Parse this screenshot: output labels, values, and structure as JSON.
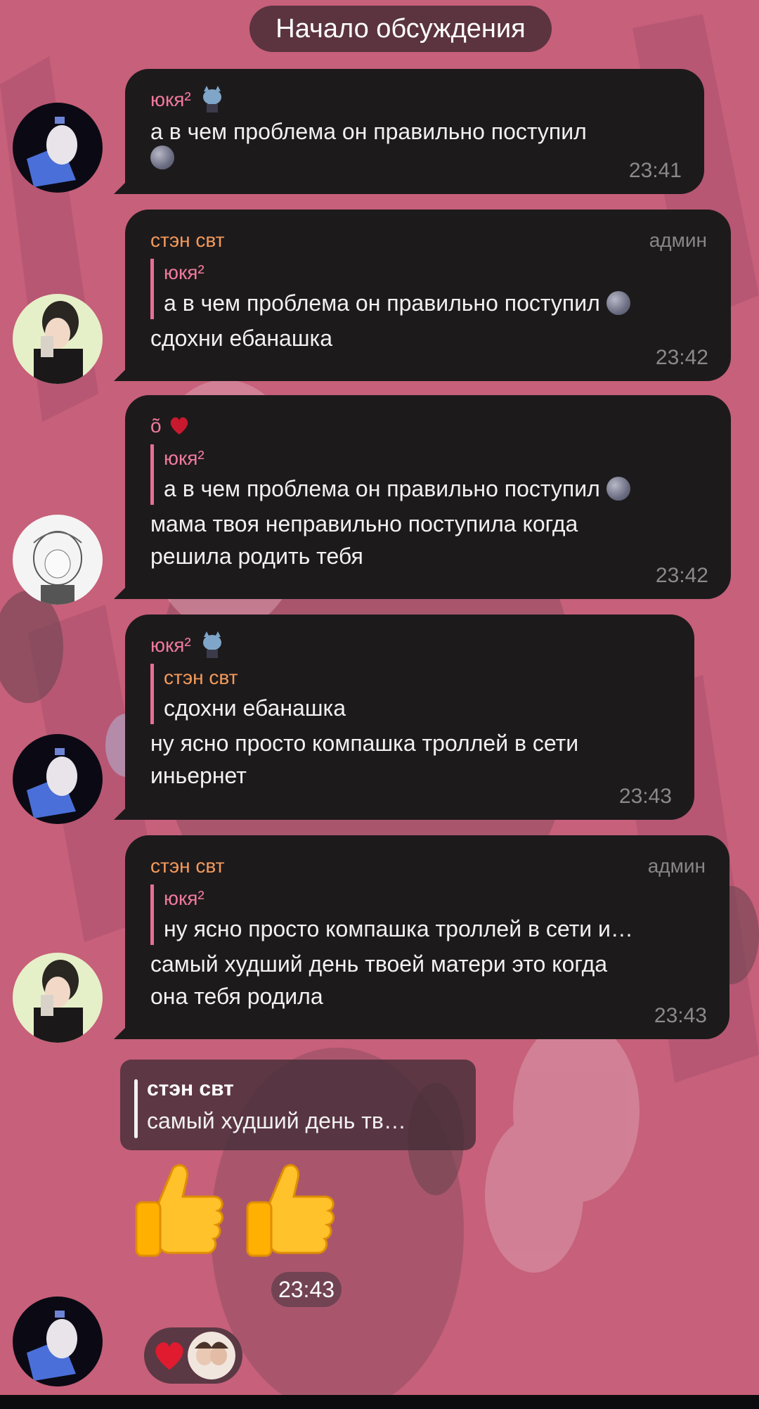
{
  "header": {
    "title": "Начало обсуждения"
  },
  "messages": [
    {
      "author": "юкя²",
      "text": "а в чем проблема он правильно поступил",
      "time": "23:41"
    },
    {
      "author": "стэн свт",
      "role": "админ",
      "quote": {
        "author": "юкя²",
        "text": "а в чем проблема он правильно поступил"
      },
      "text": "сдохни ебанашка",
      "time": "23:42"
    },
    {
      "author": "õ",
      "role": "",
      "quote": {
        "author": "юкя²",
        "text": "а в чем проблема он правильно поступил"
      },
      "text_line1": "мама твоя неправильно поступила когда",
      "text_line2": "решила родить тебя",
      "time": "23:42"
    },
    {
      "author": "юкя²",
      "quote": {
        "author": "стэн свт",
        "text": "сдохни ебанашка"
      },
      "text_line1": "ну ясно просто компашка троллей в сети",
      "text_line2": "иньернет",
      "time": "23:43"
    },
    {
      "author": "стэн свт",
      "role": "админ",
      "quote": {
        "author": "юкя²",
        "text": "ну ясно просто компашка троллей в сети и…"
      },
      "text_line1": "самый худший день твоей матери это когда",
      "text_line2": "она тебя родила",
      "time": "23:43"
    }
  ],
  "reply_card": {
    "author": "стэн свт",
    "text": "самый худший день тв…"
  },
  "sticker_message": {
    "time": "23:43"
  },
  "colors": {
    "bubble": "#1d1a1c",
    "accent_pink": "#f07a9c",
    "accent_orange": "#f49a5a",
    "wallpaper": "#c7607a"
  }
}
